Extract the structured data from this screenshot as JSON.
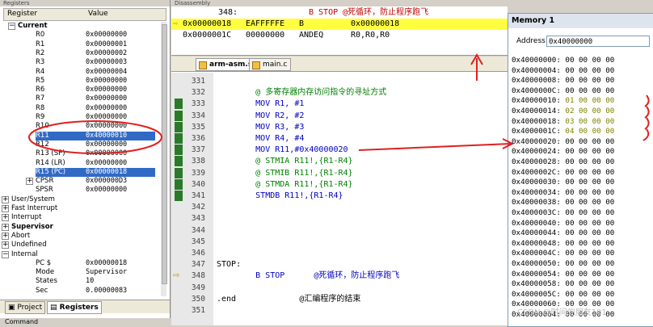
{
  "registers_panel": {
    "title": "Registers",
    "col_register": "Register",
    "col_value": "Value",
    "rows": [
      {
        "name": "Current",
        "value": "",
        "indent": 1,
        "bold": true,
        "expander": "⊟"
      },
      {
        "name": "R0",
        "value": "0x00000000",
        "indent": 3
      },
      {
        "name": "R1",
        "value": "0x00000001",
        "indent": 3
      },
      {
        "name": "R2",
        "value": "0x00000002",
        "indent": 3
      },
      {
        "name": "R3",
        "value": "0x00000003",
        "indent": 3
      },
      {
        "name": "R4",
        "value": "0x00000004",
        "indent": 3
      },
      {
        "name": "R5",
        "value": "0x00000000",
        "indent": 3
      },
      {
        "name": "R6",
        "value": "0x00000000",
        "indent": 3
      },
      {
        "name": "R7",
        "value": "0x00000000",
        "indent": 3
      },
      {
        "name": "R8",
        "value": "0x00000000",
        "indent": 3
      },
      {
        "name": "R9",
        "value": "0x00000000",
        "indent": 3
      },
      {
        "name": "R10",
        "value": "0x00000000",
        "indent": 3
      },
      {
        "name": "R11",
        "value": "0x40000010",
        "indent": 3,
        "selected": true
      },
      {
        "name": "R12",
        "value": "0x00000000",
        "indent": 3
      },
      {
        "name": "R13 (SP)",
        "value": "0x00000000",
        "indent": 3
      },
      {
        "name": "R14 (LR)",
        "value": "0x00000000",
        "indent": 3
      },
      {
        "name": "R15 (PC)",
        "value": "0x00000018",
        "indent": 3,
        "selected": true
      },
      {
        "name": "CPSR",
        "value": "0x000000D3",
        "indent": 2,
        "expander": "⊞"
      },
      {
        "name": "SPSR",
        "value": "0x00000000",
        "indent": 3
      },
      {
        "name": "User/System",
        "value": "",
        "indent": 0,
        "expander": "⊞"
      },
      {
        "name": "Fast Interrupt",
        "value": "",
        "indent": 0,
        "expander": "⊞"
      },
      {
        "name": "Interrupt",
        "value": "",
        "indent": 0,
        "expander": "⊞"
      },
      {
        "name": "Supervisor",
        "value": "",
        "indent": 0,
        "expander": "⊞",
        "bold": true
      },
      {
        "name": "Abort",
        "value": "",
        "indent": 0,
        "expander": "⊞"
      },
      {
        "name": "Undefined",
        "value": "",
        "indent": 0,
        "expander": "⊞"
      },
      {
        "name": "Internal",
        "value": "",
        "indent": 0,
        "expander": "⊟"
      },
      {
        "name": "PC  $",
        "value": "0x00000018",
        "indent": 3
      },
      {
        "name": "Mode",
        "value": "Supervisor",
        "indent": 3
      },
      {
        "name": "States",
        "value": "10",
        "indent": 3
      },
      {
        "name": "Sec",
        "value": "0.00000083",
        "indent": 3
      }
    ],
    "tabs": [
      "Project",
      "Registers"
    ],
    "command_label": "Command"
  },
  "disassembly": {
    "title": "Disassembly",
    "rows": [
      {
        "addr": "348:",
        "opcode": "",
        "mnemonic": "",
        "operands": "B STOP      @死循环，防止程序跑飞",
        "source": true
      },
      {
        "addr": "0x00000018",
        "opcode": "EAFFFFFE",
        "mnemonic": "B",
        "operands": "0x00000018",
        "current": true
      },
      {
        "addr": "0x0000001C",
        "opcode": "00000000",
        "mnemonic": "ANDEQ",
        "operands": "R0,R0,R0"
      }
    ]
  },
  "editor": {
    "tabs": [
      {
        "label": "arm-asm.s",
        "active": true
      },
      {
        "label": "main.c",
        "active": false
      }
    ],
    "lines": [
      {
        "n": "331",
        "code": ""
      },
      {
        "n": "332",
        "code": "        @ 多寄存器内存访问指令的寻址方式",
        "kind": "cmt"
      },
      {
        "n": "333",
        "code": "        MOV R1, #1",
        "mark": true
      },
      {
        "n": "334",
        "code": "        MOV R2, #2",
        "mark": true
      },
      {
        "n": "335",
        "code": "        MOV R3, #3",
        "mark": true
      },
      {
        "n": "336",
        "code": "        MOV R4, #4",
        "mark": true
      },
      {
        "n": "337",
        "code": "        MOV R11,#0x40000020",
        "mark": true
      },
      {
        "n": "338",
        "code": "        @ STMIA R11!,{R1-R4}",
        "mark": true
      },
      {
        "n": "339",
        "code": "        @ STMIB R11!,{R1-R4}",
        "mark": true
      },
      {
        "n": "340",
        "code": "        @ STMDA R11!,{R1-R4}",
        "mark": true
      },
      {
        "n": "341",
        "code": "        STMDB R11!,{R1-R4}",
        "mark": true
      },
      {
        "n": "342",
        "code": ""
      },
      {
        "n": "343",
        "code": ""
      },
      {
        "n": "344",
        "code": ""
      },
      {
        "n": "345",
        "code": ""
      },
      {
        "n": "346",
        "code": ""
      },
      {
        "n": "347",
        "code": "STOP:"
      },
      {
        "n": "348",
        "code": "        B STOP      @死循环，防止程序跑飞",
        "current": true
      },
      {
        "n": "349",
        "code": ""
      },
      {
        "n": "350",
        "code": ".end             @汇编程序的结束"
      },
      {
        "n": "351",
        "code": ""
      }
    ]
  },
  "memory": {
    "title": "Memory 1",
    "address_label": "Address:",
    "address_value": "0x40000000",
    "rows": [
      {
        "addr": "0x40000000:",
        "bytes": "00 00 00 00"
      },
      {
        "addr": "0x40000004:",
        "bytes": "00 00 00 00"
      },
      {
        "addr": "0x40000008:",
        "bytes": "00 00 00 00"
      },
      {
        "addr": "0x4000000C:",
        "bytes": "00 00 00 00"
      },
      {
        "addr": "0x40000010:",
        "bytes": "01 00 00 00",
        "changed": true
      },
      {
        "addr": "0x40000014:",
        "bytes": "02 00 00 00",
        "changed": true
      },
      {
        "addr": "0x40000018:",
        "bytes": "03 00 00 00",
        "changed": true
      },
      {
        "addr": "0x4000001C:",
        "bytes": "04 00 00 00",
        "changed": true
      },
      {
        "addr": "0x40000020:",
        "bytes": "00 00 00 00"
      },
      {
        "addr": "0x40000024:",
        "bytes": "00 00 00 00"
      },
      {
        "addr": "0x40000028:",
        "bytes": "00 00 00 00"
      },
      {
        "addr": "0x4000002C:",
        "bytes": "00 00 00 00"
      },
      {
        "addr": "0x40000030:",
        "bytes": "00 00 00 00"
      },
      {
        "addr": "0x40000034:",
        "bytes": "00 00 00 00"
      },
      {
        "addr": "0x40000038:",
        "bytes": "00 00 00 00"
      },
      {
        "addr": "0x4000003C:",
        "bytes": "00 00 00 00"
      },
      {
        "addr": "0x40000040:",
        "bytes": "00 00 00 00"
      },
      {
        "addr": "0x40000044:",
        "bytes": "00 00 00 00"
      },
      {
        "addr": "0x40000048:",
        "bytes": "00 00 00 00"
      },
      {
        "addr": "0x4000004C:",
        "bytes": "00 00 00 00"
      },
      {
        "addr": "0x40000050:",
        "bytes": "00 00 00 00"
      },
      {
        "addr": "0x40000054:",
        "bytes": "00 00 00 00"
      },
      {
        "addr": "0x40000058:",
        "bytes": "00 00 00 00"
      },
      {
        "addr": "0x4000005C:",
        "bytes": "00 00 00 00"
      },
      {
        "addr": "0x40000060:",
        "bytes": "00 00 00 00"
      },
      {
        "addr": "0x40000064:",
        "bytes": "00 00 00 00"
      }
    ],
    "watermark": "CSDN @时间的朋友101"
  },
  "colors": {
    "selection": "#316ac5",
    "current_line": "#ffff40",
    "annotation_red": "#e02020",
    "changed_bytes": "#808000"
  }
}
